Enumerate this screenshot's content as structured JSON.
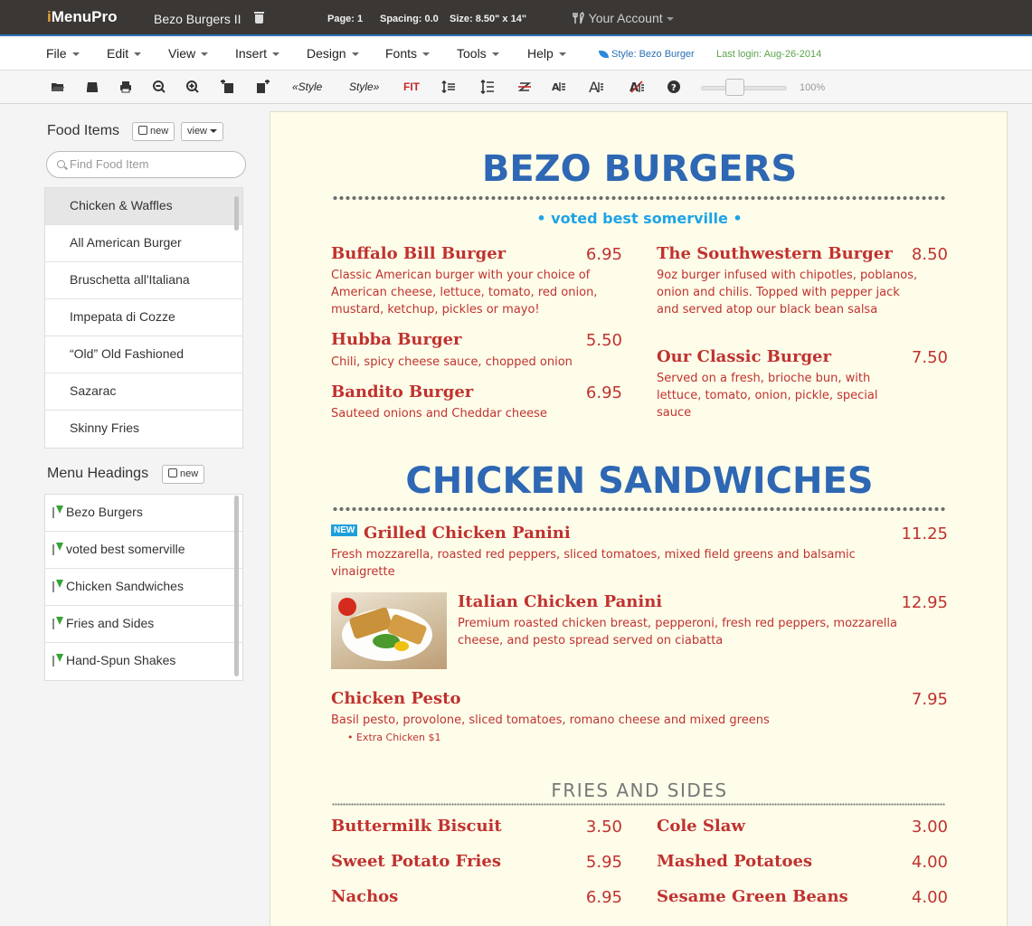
{
  "app": {
    "logo_i": "i",
    "logo_rest": "MenuPro",
    "doc_title": "Bezo Burgers II",
    "page": "Page: 1",
    "spacing": "Spacing: 0.0",
    "size": "Size: 8.50\" x 14\"",
    "account": "Your Account"
  },
  "menubar": {
    "items": [
      "File",
      "Edit",
      "View",
      "Insert",
      "Design",
      "Fonts",
      "Tools",
      "Help"
    ],
    "style": "Style: Bezo Burger",
    "last_login": "Last login: Aug-26-2014"
  },
  "toolbar": {
    "style_prev": "«Style",
    "style_next": "Style»",
    "fit": "FIT",
    "zoom": "100%",
    "zoom_level": 0.37,
    "icons": [
      "open-folder-icon",
      "save-icon",
      "print-icon",
      "zoom-out-icon",
      "zoom-in-icon",
      "page-layout-icon",
      "page-settings-icon",
      "line-spacing-icon",
      "line-spacing-more-icon",
      "strikethrough-icon",
      "font-small-icon",
      "font-large-icon",
      "font-clear-icon",
      "help-icon"
    ]
  },
  "sidebar": {
    "food_title": "Food Items",
    "new_label": "new",
    "view_label": "view",
    "search_placeholder": "Find Food Item",
    "food_items": [
      "Chicken & Waffles",
      "All American Burger",
      "Bruschetta all'Italiana",
      "Impepata di Cozze",
      "“Old” Old Fashioned",
      "Sazarac",
      "Skinny Fries"
    ],
    "headings_title": "Menu Headings",
    "headings": [
      "Bezo Burgers",
      "voted best somerville",
      "Chicken Sandwiches",
      "Fries and Sides",
      "Hand-Spun Shakes"
    ]
  },
  "menu": {
    "title1": "BEZO BURGERS",
    "tagline": "• voted best somerville •",
    "burgers_left": [
      {
        "name": "Buffalo Bill Burger",
        "price": "6.95",
        "desc": "Classic American burger with your choice of American cheese, lettuce, tomato, red onion, mustard, ketchup, pickles or mayo!"
      },
      {
        "name": "Hubba Burger",
        "price": "5.50",
        "desc": "Chili, spicy cheese sauce, chopped onion"
      },
      {
        "name": "Bandito Burger",
        "price": "6.95",
        "desc": "Sauteed onions and Cheddar cheese"
      }
    ],
    "burgers_right": [
      {
        "name": "The Southwestern Burger",
        "price": "8.50",
        "desc": "9oz burger infused with chipotles, poblanos, onion and chilis. Topped with pepper jack and served atop our black bean salsa"
      },
      {
        "name": "Our Classic Burger",
        "price": "7.50",
        "desc": "Served on a fresh, brioche bun, with lettuce, tomato, onion, pickle, special sauce"
      }
    ],
    "title2": "CHICKEN SANDWICHES",
    "new_badge": "NEW",
    "chicken": [
      {
        "name": "Grilled Chicken Panini",
        "price": "11.25",
        "desc": "Fresh mozzarella, roasted red peppers, sliced tomatoes, mixed field greens and balsamic vinaigrette"
      },
      {
        "name": "Italian Chicken Panini",
        "price": "12.95",
        "desc": "Premium roasted chicken breast, pepperoni, fresh red peppers, mozzarella cheese, and pesto spread served on ciabatta"
      },
      {
        "name": "Chicken Pesto",
        "price": "7.95",
        "desc": "Basil pesto, provolone, sliced tomatoes, romano cheese and mixed greens"
      }
    ],
    "addon": "• Extra Chicken $1",
    "title3": "FRIES AND SIDES",
    "sides_left": [
      {
        "name": "Buttermilk Biscuit",
        "price": "3.50"
      },
      {
        "name": "Sweet Potato Fries",
        "price": "5.95"
      },
      {
        "name": "Nachos",
        "price": "6.95"
      }
    ],
    "sides_right": [
      {
        "name": "Cole Slaw",
        "price": "3.00"
      },
      {
        "name": "Mashed Potatoes",
        "price": "4.00"
      },
      {
        "name": "Sesame Green Beans",
        "price": "4.00"
      }
    ]
  }
}
